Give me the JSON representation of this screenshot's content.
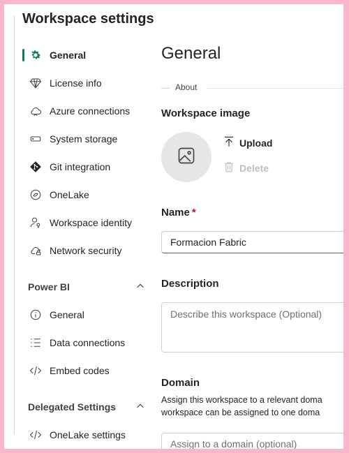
{
  "panel": {
    "title": "Workspace settings"
  },
  "nav": {
    "items": [
      {
        "label": "General",
        "icon": "gear-icon",
        "active": true
      },
      {
        "label": "License info",
        "icon": "diamond-icon"
      },
      {
        "label": "Azure connections",
        "icon": "cloud-icon"
      },
      {
        "label": "System storage",
        "icon": "storage-icon"
      },
      {
        "label": "Git integration",
        "icon": "git-icon"
      },
      {
        "label": "OneLake",
        "icon": "onelake-icon"
      },
      {
        "label": "Workspace identity",
        "icon": "identity-icon"
      },
      {
        "label": "Network security",
        "icon": "cloud-lock-icon"
      }
    ],
    "power_bi": {
      "title": "Power BI",
      "items": [
        {
          "label": "General",
          "icon": "info-icon"
        },
        {
          "label": "Data connections",
          "icon": "list-icon"
        },
        {
          "label": "Embed codes",
          "icon": "code-icon"
        }
      ]
    },
    "delegated": {
      "title": "Delegated Settings",
      "items": [
        {
          "label": "OneLake settings",
          "icon": "code-icon"
        }
      ]
    }
  },
  "main": {
    "title": "General",
    "about_label": "About",
    "workspace_image_label": "Workspace image",
    "upload_label": "Upload",
    "delete_label": "Delete",
    "name_label": "Name",
    "required_mark": "*",
    "name_value": "Formacion Fabric",
    "description_label": "Description",
    "description_placeholder": "Describe this workspace (Optional)",
    "domain_label": "Domain",
    "domain_desc_line1": "Assign this workspace to a relevant doma",
    "domain_desc_line2": "workspace can be assigned to one doma",
    "domain_placeholder": "Assign to a domain (optional)"
  },
  "colors": {
    "accent": "#117865",
    "frame": "#f8b6cf",
    "required": "#c50f1f"
  }
}
